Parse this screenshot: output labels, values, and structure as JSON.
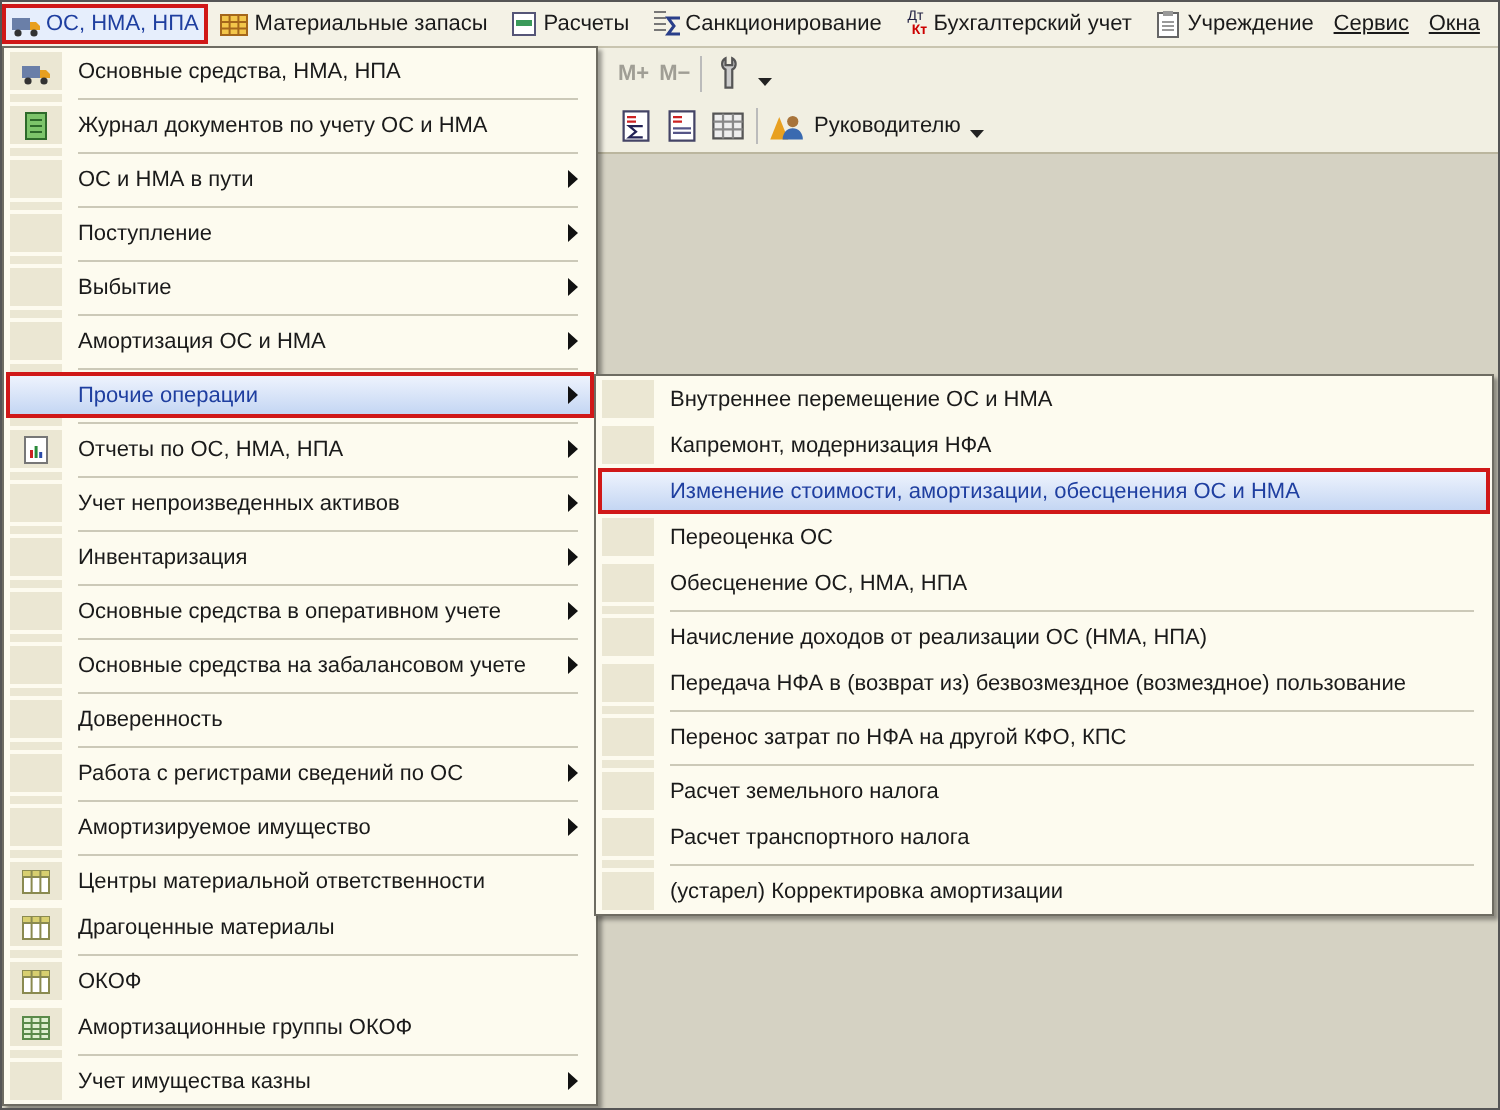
{
  "menubar": [
    {
      "label": "ОС, НМА, НПА",
      "kind": "truck",
      "selected": true
    },
    {
      "label": "Материальные запасы",
      "kind": "boxes",
      "selected": false
    },
    {
      "label": "Расчеты",
      "kind": "doc",
      "selected": false
    },
    {
      "label": "Санкционирование",
      "kind": "sigma",
      "selected": false
    },
    {
      "label": "Бухгалтерский учет",
      "kind": "dtkt",
      "icon_text": [
        "Дт",
        "Кт"
      ],
      "selected": false
    },
    {
      "label": "Учреждение",
      "kind": "clipboard",
      "selected": false
    },
    {
      "label": "Сервис",
      "kind": "plain",
      "selected": false
    },
    {
      "label": "Окна",
      "kind": "plain",
      "selected": false
    }
  ],
  "toolbar": {
    "row_1": [
      {
        "kind": "text",
        "label": "M+"
      },
      {
        "kind": "text",
        "label": "M−"
      },
      {
        "kind": "sep"
      },
      {
        "kind": "wrench"
      },
      {
        "kind": "caret"
      }
    ],
    "row_2": [
      {
        "kind": "dtsigma"
      },
      {
        "kind": "dtdoc"
      },
      {
        "kind": "grid"
      },
      {
        "kind": "sep"
      },
      {
        "kind": "person"
      },
      {
        "kind": "text",
        "label": "Руководителю"
      },
      {
        "kind": "caret"
      }
    ]
  },
  "menu": {
    "groups": [
      [
        {
          "label": "Основные средства, НМА, НПА",
          "kind": "truck",
          "submenu": false,
          "selected": false
        }
      ],
      [
        {
          "label": "Журнал документов по учету ОС и НМА",
          "kind": "journal",
          "submenu": false,
          "selected": false
        }
      ],
      [
        {
          "label": "ОС и НМА в пути",
          "kind": "plain",
          "submenu": true,
          "selected": false
        }
      ],
      [
        {
          "label": "Поступление",
          "kind": "plain",
          "submenu": true,
          "selected": false
        }
      ],
      [
        {
          "label": "Выбытие",
          "kind": "plain",
          "submenu": true,
          "selected": false
        }
      ],
      [
        {
          "label": "Амортизация ОС и НМА",
          "kind": "plain",
          "submenu": true,
          "selected": false
        }
      ],
      [
        {
          "label": "Прочие операции",
          "kind": "plain",
          "submenu": true,
          "selected": true
        }
      ],
      [
        {
          "label": "Отчеты по ОС, НМА, НПА",
          "kind": "report",
          "submenu": true,
          "selected": false
        }
      ],
      [
        {
          "label": "Учет непроизведенных активов",
          "kind": "plain",
          "submenu": true,
          "selected": false
        }
      ],
      [
        {
          "label": "Инвентаризация",
          "kind": "plain",
          "submenu": true,
          "selected": false
        }
      ],
      [
        {
          "label": "Основные средства в оперативном учете",
          "kind": "plain",
          "submenu": true,
          "selected": false
        }
      ],
      [
        {
          "label": "Основные средства на забалансовом учете",
          "kind": "plain",
          "submenu": true,
          "selected": false
        }
      ],
      [
        {
          "label": "Доверенность",
          "kind": "plain",
          "submenu": false,
          "selected": false
        }
      ],
      [
        {
          "label": "Работа с регистрами сведений по ОС",
          "kind": "plain",
          "submenu": true,
          "selected": false
        }
      ],
      [
        {
          "label": "Амортизируемое имущество",
          "kind": "plain",
          "submenu": true,
          "selected": false
        }
      ],
      [
        {
          "label": "Центры материальной ответственности",
          "kind": "table",
          "submenu": false,
          "selected": false
        },
        {
          "label": "Драгоценные материалы",
          "kind": "table",
          "submenu": false,
          "selected": false
        }
      ],
      [
        {
          "label": "ОКОФ",
          "kind": "table",
          "submenu": false,
          "selected": false
        },
        {
          "label": "Амортизационные группы ОКОФ",
          "kind": "table-green",
          "submenu": false,
          "selected": false
        }
      ],
      [
        {
          "label": "Учет имущества казны",
          "kind": "plain",
          "submenu": true,
          "selected": false
        }
      ]
    ]
  },
  "submenu": {
    "groups": [
      [
        {
          "label": "Внутреннее перемещение ОС и НМА",
          "selected": false
        },
        {
          "label": "Капремонт, модернизация НФА",
          "selected": false
        },
        {
          "label": "Изменение стоимости, амортизации, обесценения ОС и НМА",
          "selected": true
        },
        {
          "label": "Переоценка ОС",
          "selected": false
        },
        {
          "label": "Обесценение ОС, НМА, НПА",
          "selected": false
        }
      ],
      [
        {
          "label": "Начисление доходов от реализации ОС (НМА, НПА)",
          "selected": false
        },
        {
          "label": "Передача НФА в (возврат из) безвозмездное (возмездное) пользование",
          "selected": false
        }
      ],
      [
        {
          "label": "Перенос затрат по НФА на другой КФО, КПС",
          "selected": false
        }
      ],
      [
        {
          "label": "Расчет земельного налога",
          "selected": false
        },
        {
          "label": "Расчет транспортного налога",
          "selected": false
        }
      ],
      [
        {
          "label": "(устарел) Корректировка амортизации",
          "selected": false
        }
      ]
    ]
  }
}
